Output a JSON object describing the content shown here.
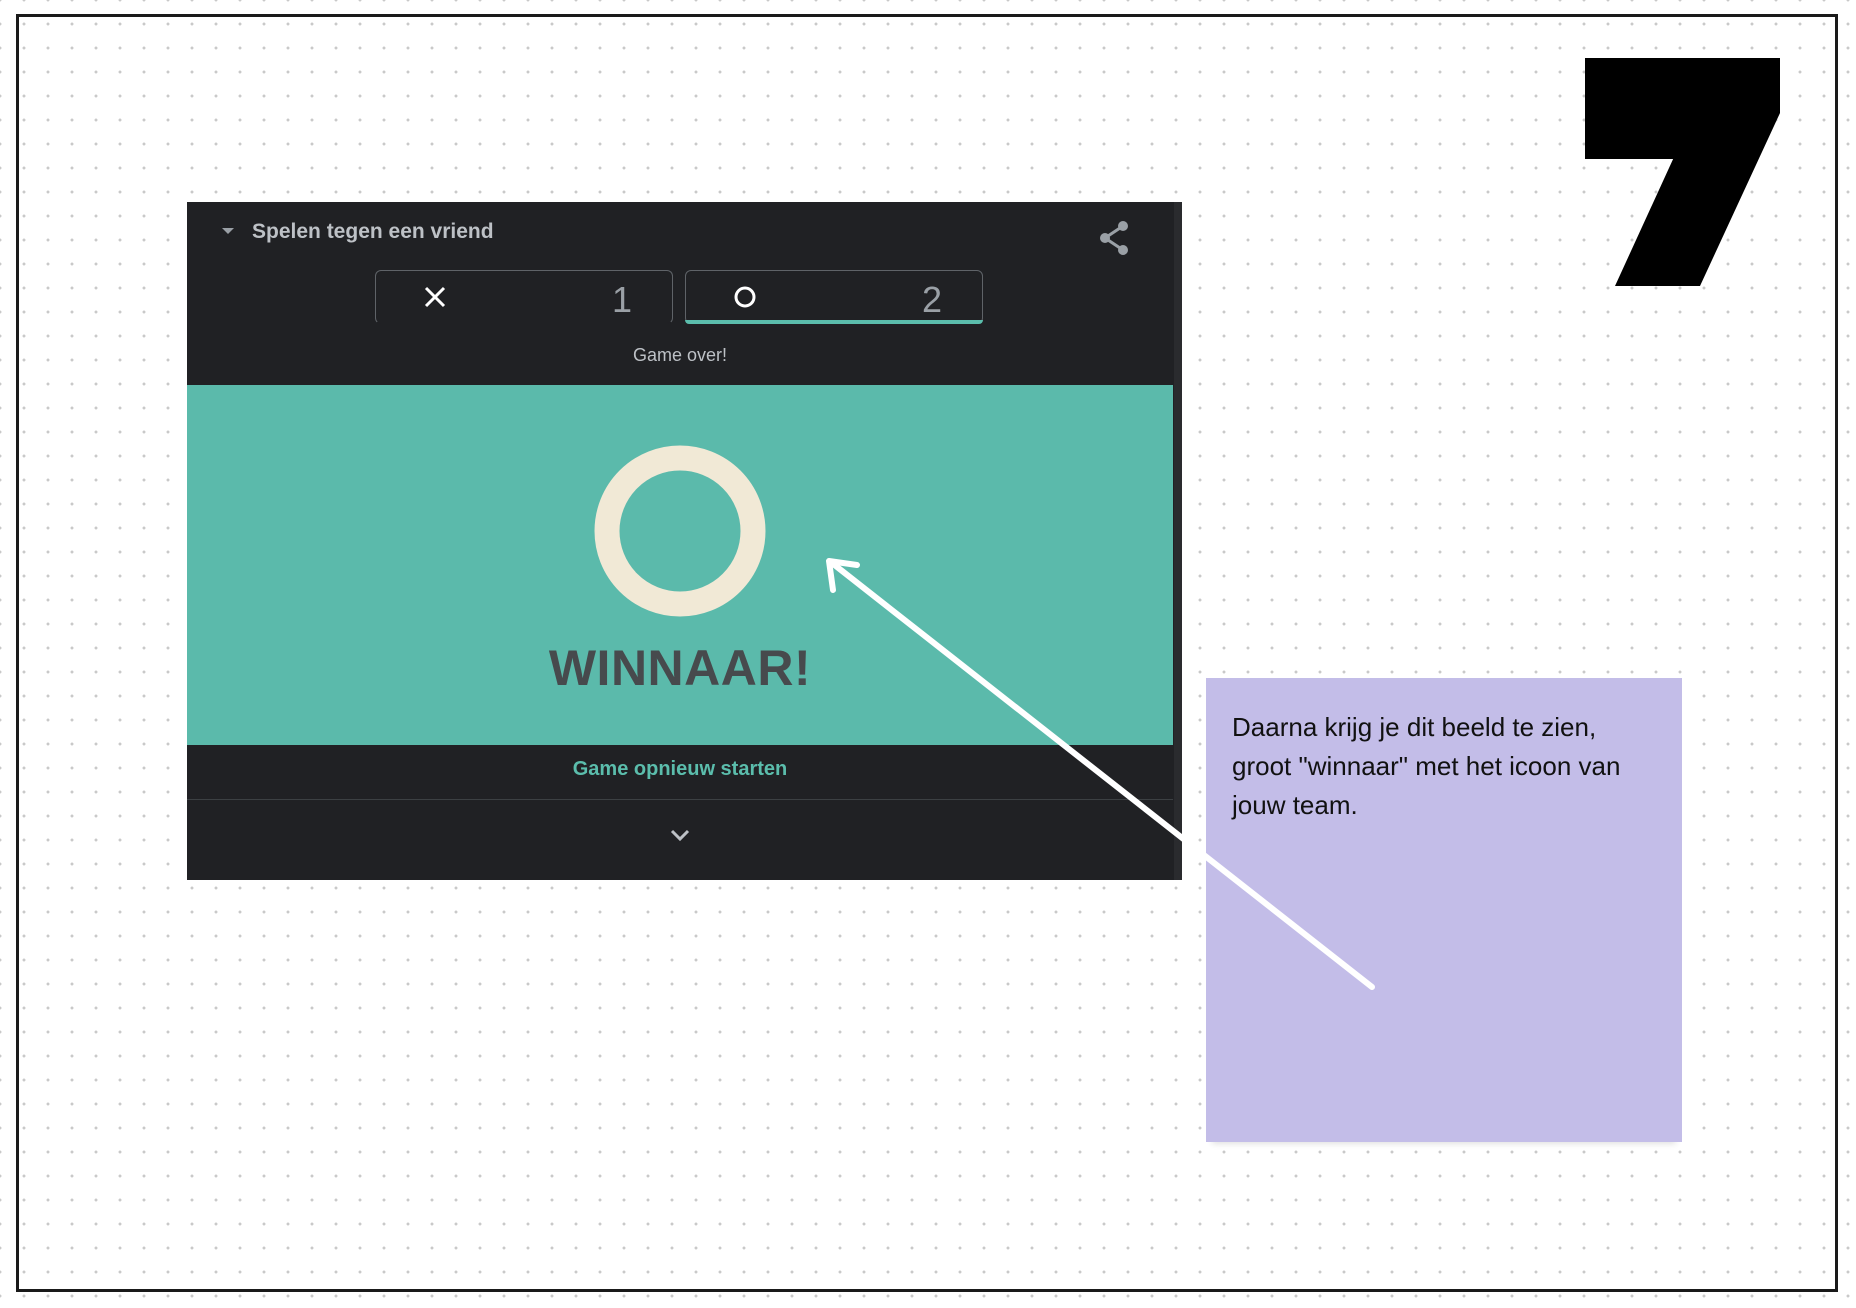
{
  "slide": {
    "step_number": "7"
  },
  "widget": {
    "title": "Spelen tegen een vriend",
    "players": [
      {
        "symbol": "X",
        "score": "1",
        "active": false
      },
      {
        "symbol": "O",
        "score": "2",
        "active": true
      }
    ],
    "status": "Game over!",
    "result_title": "WINNAAR!",
    "restart_label": "Game opnieuw starten",
    "colors": {
      "background": "#202124",
      "accent": "#5bbdac",
      "result_panel": "#5bbaab",
      "winner_icon": "#f1e9d6"
    },
    "icons": {
      "header_caret": "caret-down-icon",
      "share": "share-icon",
      "x_symbol": "x-icon",
      "o_symbol": "o-icon",
      "winner": "o-icon",
      "expand": "chevron-down-icon"
    }
  },
  "note": {
    "text": "Daarna krijg je dit beeld te zien, groot \"winnaar\" met het icoon van jouw team.",
    "color": "#c3bde8"
  }
}
